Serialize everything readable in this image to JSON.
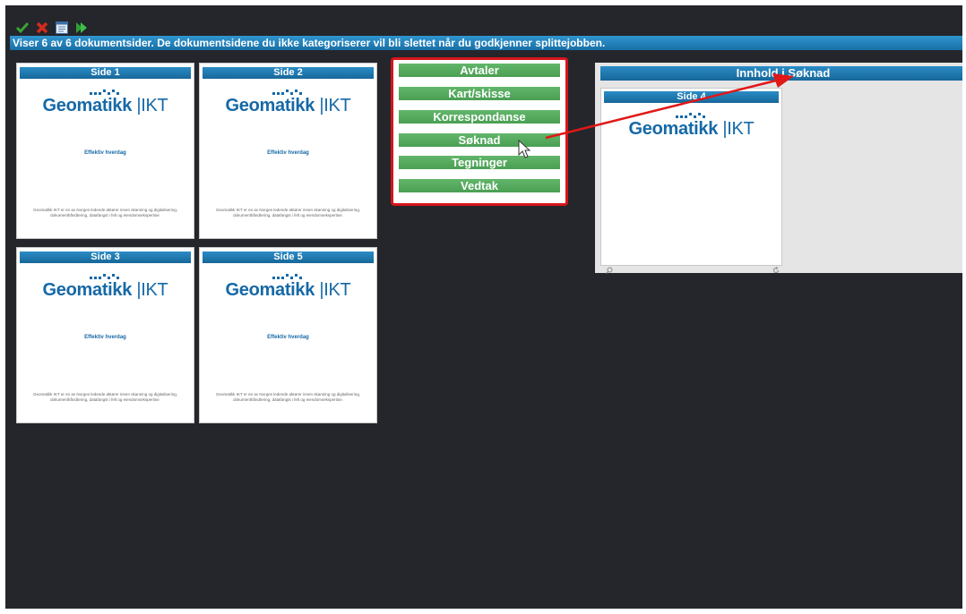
{
  "toolbar": {
    "icons": [
      "check-icon",
      "cross-icon",
      "document-icon",
      "forward-icon"
    ],
    "colors": {
      "check": "#3aa335",
      "cross": "#d42b1f",
      "forward": "#2f9e3a"
    }
  },
  "info": {
    "text": "Viser 6 av 6 dokumentsider. De dokumentsidene du ikke kategoriserer vil bli slettet når du godkjenner splittejobben."
  },
  "doc": {
    "logo_main": "Geomatikk",
    "logo_sep": "|",
    "logo_ikt": "IKT",
    "tagline": "Effektiv hverdag",
    "fineprint": "Geomatikk IKT er en av Norges ledende aktører innen skanning og digitalisering, dokumenthåndtering, datafangst i felt og eiendomsekspertise."
  },
  "pages": [
    {
      "label": "Side 1"
    },
    {
      "label": "Side 2"
    },
    {
      "label": "Side 3"
    },
    {
      "label": "Side 5"
    }
  ],
  "categories": [
    {
      "label": "Avtaler"
    },
    {
      "label": "Kart/skisse"
    },
    {
      "label": "Korrespondanse"
    },
    {
      "label": "Søknad"
    },
    {
      "label": "Tegninger"
    },
    {
      "label": "Vedtak"
    }
  ],
  "content_pane": {
    "title": "Innhold i Søknad",
    "page_label": "Side 4"
  },
  "colors": {
    "app_bg": "#24262b",
    "header_blue": "#1a77b3",
    "category_green": "#55aa5e",
    "highlight_red": "#d6151b",
    "logo_blue": "#1669a7"
  }
}
